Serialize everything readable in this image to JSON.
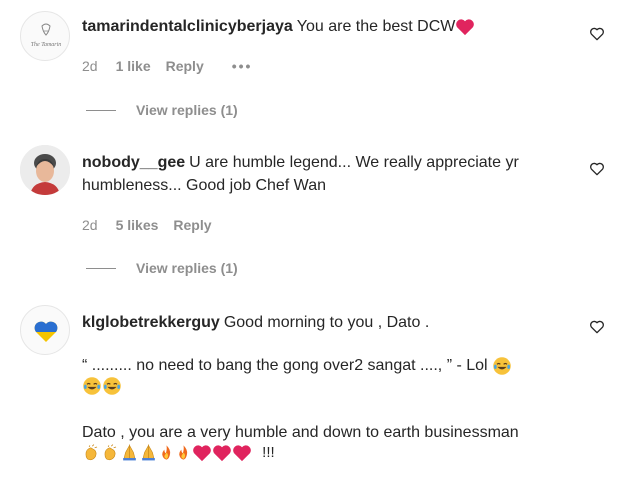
{
  "comments": [
    {
      "username": "tamarindentalclinicyberjaya",
      "text": "You are the best DCW",
      "time": "2d",
      "likes": "1 like",
      "reply": "Reply",
      "more": "•••",
      "view_replies": "View replies (1)",
      "avatar_text": "The Tamarin"
    },
    {
      "username": "nobody__gee",
      "text": "U are humble legend... We really appreciate yr humbleness... Good job Chef Wan",
      "time": "2d",
      "likes": "5 likes",
      "reply": "Reply",
      "view_replies": "View replies (1)"
    },
    {
      "username": "klglobetrekkerguy",
      "text_line1": "Good morning to you , Dato .",
      "text_line2": "“ ......... no need to bang the gong over2 sangat ...., ” - Lol",
      "text_line3": "Dato , you are a very humble and down to earth businessman",
      "text_end": "!!!"
    }
  ],
  "icons": {
    "heart": "heart-outline-icon",
    "red_heart": "red-heart-emoji",
    "laugh": "tears-of-joy-emoji",
    "clap": "clapping-hands-emoji",
    "pray": "folded-hands-emoji",
    "fire": "fire-emoji"
  },
  "colors": {
    "text": "#262626",
    "muted": "#8e8e8e",
    "heart_red": "#e0245e"
  }
}
